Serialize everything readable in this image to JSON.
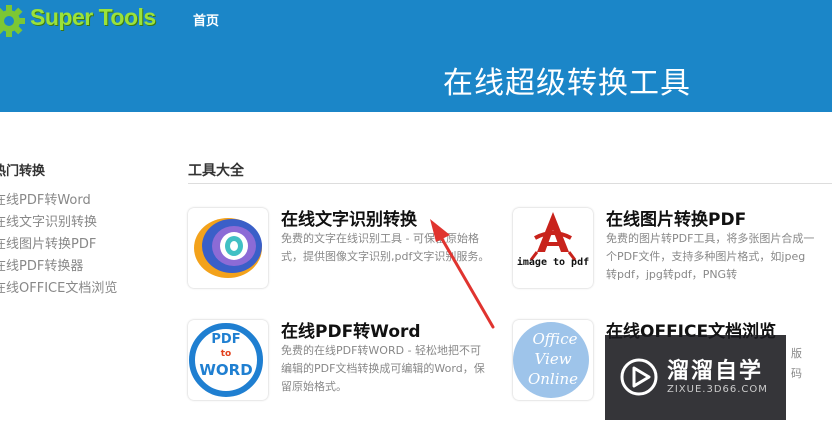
{
  "header": {
    "logo_text": "Super Tools",
    "nav_home": "首页",
    "hero_title": "在线超级转换工具"
  },
  "sidebar": {
    "title": "热门转换",
    "items": [
      {
        "label": "在线PDF转Word"
      },
      {
        "label": "在线文字识别转换"
      },
      {
        "label": "在线图片转换PDF"
      },
      {
        "label": "在线PDF转换器"
      },
      {
        "label": "在线OFFICE文档浏览"
      }
    ]
  },
  "tools": {
    "title": "工具大全",
    "cards": [
      {
        "title": "在线文字识别转换",
        "desc": "免费的文字在线识别工具 - 可保留原始格式，提供图像文字识别,pdf文字识别服务。",
        "icon": "ocr-icon"
      },
      {
        "title": "在线图片转换PDF",
        "desc": "免费的图片转PDF工具，将多张图片合成一个PDF文件，支持多种图片格式，如jpeg转pdf，jpg转pdf，PNG转",
        "icon": "image-to-pdf-icon",
        "icon_text": "image to pdf"
      },
      {
        "title": "在线PDF转Word",
        "desc": "免费的在线PDF转WORD - 轻松地把不可编辑的PDF文档转换成可编辑的Word，保留原始格式。",
        "icon": "pdf-to-word-icon",
        "icon_text_1": "PDF",
        "icon_text_2": "to",
        "icon_text_3": "WORD"
      },
      {
        "title": "在线OFFICE文档浏览",
        "desc_partial_1": "版",
        "desc_partial_2": "码",
        "icon": "office-view-online-icon",
        "icon_text_1": "Office",
        "icon_text_2": "View",
        "icon_text_3": "Online"
      }
    ]
  },
  "watermark": {
    "text": "溜溜自学",
    "sub": "ZIXUE.3D66.COM"
  },
  "colors": {
    "header_bg": "#1b86c8",
    "logo_green": "#9be23a",
    "arrow_red": "#e0342f"
  }
}
